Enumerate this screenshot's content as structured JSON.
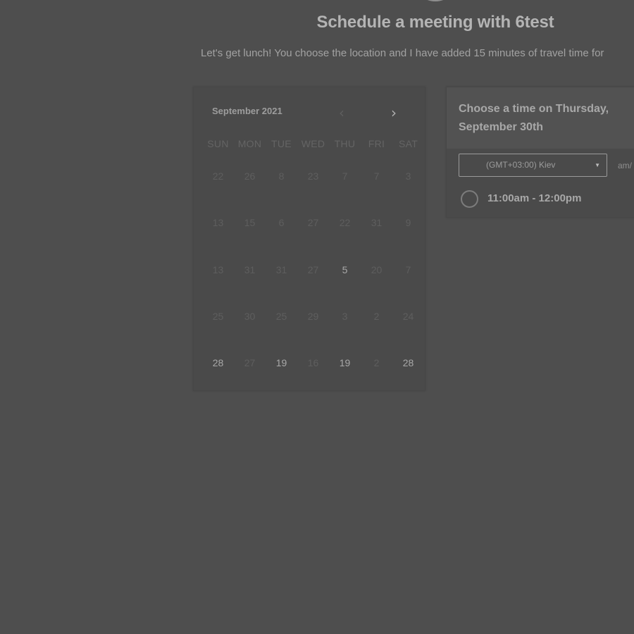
{
  "header": {
    "title": "Schedule a meeting with 6test",
    "subtitle": "Let's get lunch! You choose the location and I have added 15 minutes of travel time for"
  },
  "calendar": {
    "month_label": "September 2021",
    "prev_icon": "chevron-left-icon",
    "next_icon": "chevron-right-icon",
    "weekdays": [
      "SUN",
      "MON",
      "TUE",
      "WED",
      "THU",
      "FRI",
      "SAT"
    ],
    "weeks": [
      [
        "22",
        "26",
        "8",
        "23",
        "7",
        "7",
        "3"
      ],
      [
        "13",
        "15",
        "6",
        "27",
        "22",
        "31",
        "9"
      ],
      [
        "13",
        "31",
        "31",
        "27",
        "5",
        "20",
        "7"
      ],
      [
        "25",
        "30",
        "25",
        "29",
        "3",
        "2",
        "24"
      ],
      [
        "28",
        "27",
        "19",
        "16",
        "19",
        "2",
        "28"
      ]
    ],
    "available": [
      [
        2,
        4
      ],
      [
        4,
        0
      ],
      [
        4,
        2
      ],
      [
        4,
        4
      ],
      [
        4,
        6
      ]
    ]
  },
  "time_picker": {
    "heading": "Choose a time on Thursday, September 30th",
    "timezone": "(GMT+03:00) Kiev",
    "format_label": "am/",
    "slots": [
      "11:00am - 12:00pm"
    ]
  }
}
